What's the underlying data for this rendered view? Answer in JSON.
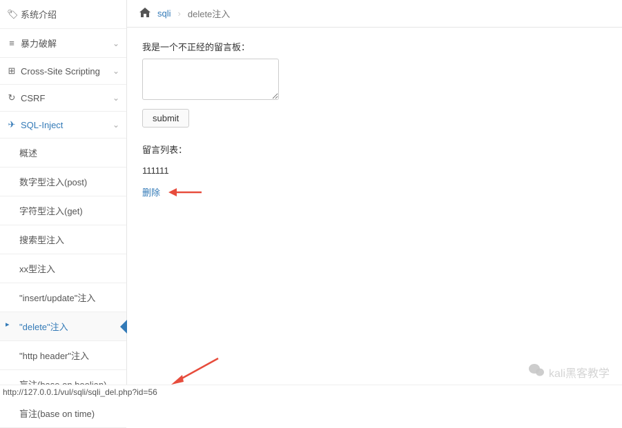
{
  "sidebar": {
    "items": [
      {
        "icon": "🏷",
        "label": "系统介绍",
        "chevron": ""
      },
      {
        "icon": "≡",
        "label": "暴力破解",
        "chevron": "⌄"
      },
      {
        "icon": "⊞",
        "label": "Cross-Site Scripting",
        "chevron": "⌄"
      },
      {
        "icon": "↻",
        "label": "CSRF",
        "chevron": "⌄"
      },
      {
        "icon": "✈",
        "label": "SQL-Inject",
        "chevron": "⌄"
      }
    ],
    "sub": [
      {
        "label": "概述"
      },
      {
        "label": "数字型注入(post)"
      },
      {
        "label": "字符型注入(get)"
      },
      {
        "label": "搜索型注入"
      },
      {
        "label": "xx型注入"
      },
      {
        "label": "\"insert/update\"注入"
      },
      {
        "label": "\"delete\"注入"
      },
      {
        "label": "\"http header\"注入"
      },
      {
        "label": "盲注(base on boolian)"
      },
      {
        "label": "盲注(base on time)"
      }
    ]
  },
  "breadcrumb": {
    "item1": "sqli",
    "item2": "delete注入"
  },
  "content": {
    "form_label": "我是一个不正经的留言板：",
    "submit": "submit",
    "list_label": "留言列表：",
    "message1": "111111",
    "delete_text": "删除"
  },
  "status_bar": "http://127.0.0.1/vul/sqli/sqli_del.php?id=56",
  "watermark": "kali黑客教学"
}
